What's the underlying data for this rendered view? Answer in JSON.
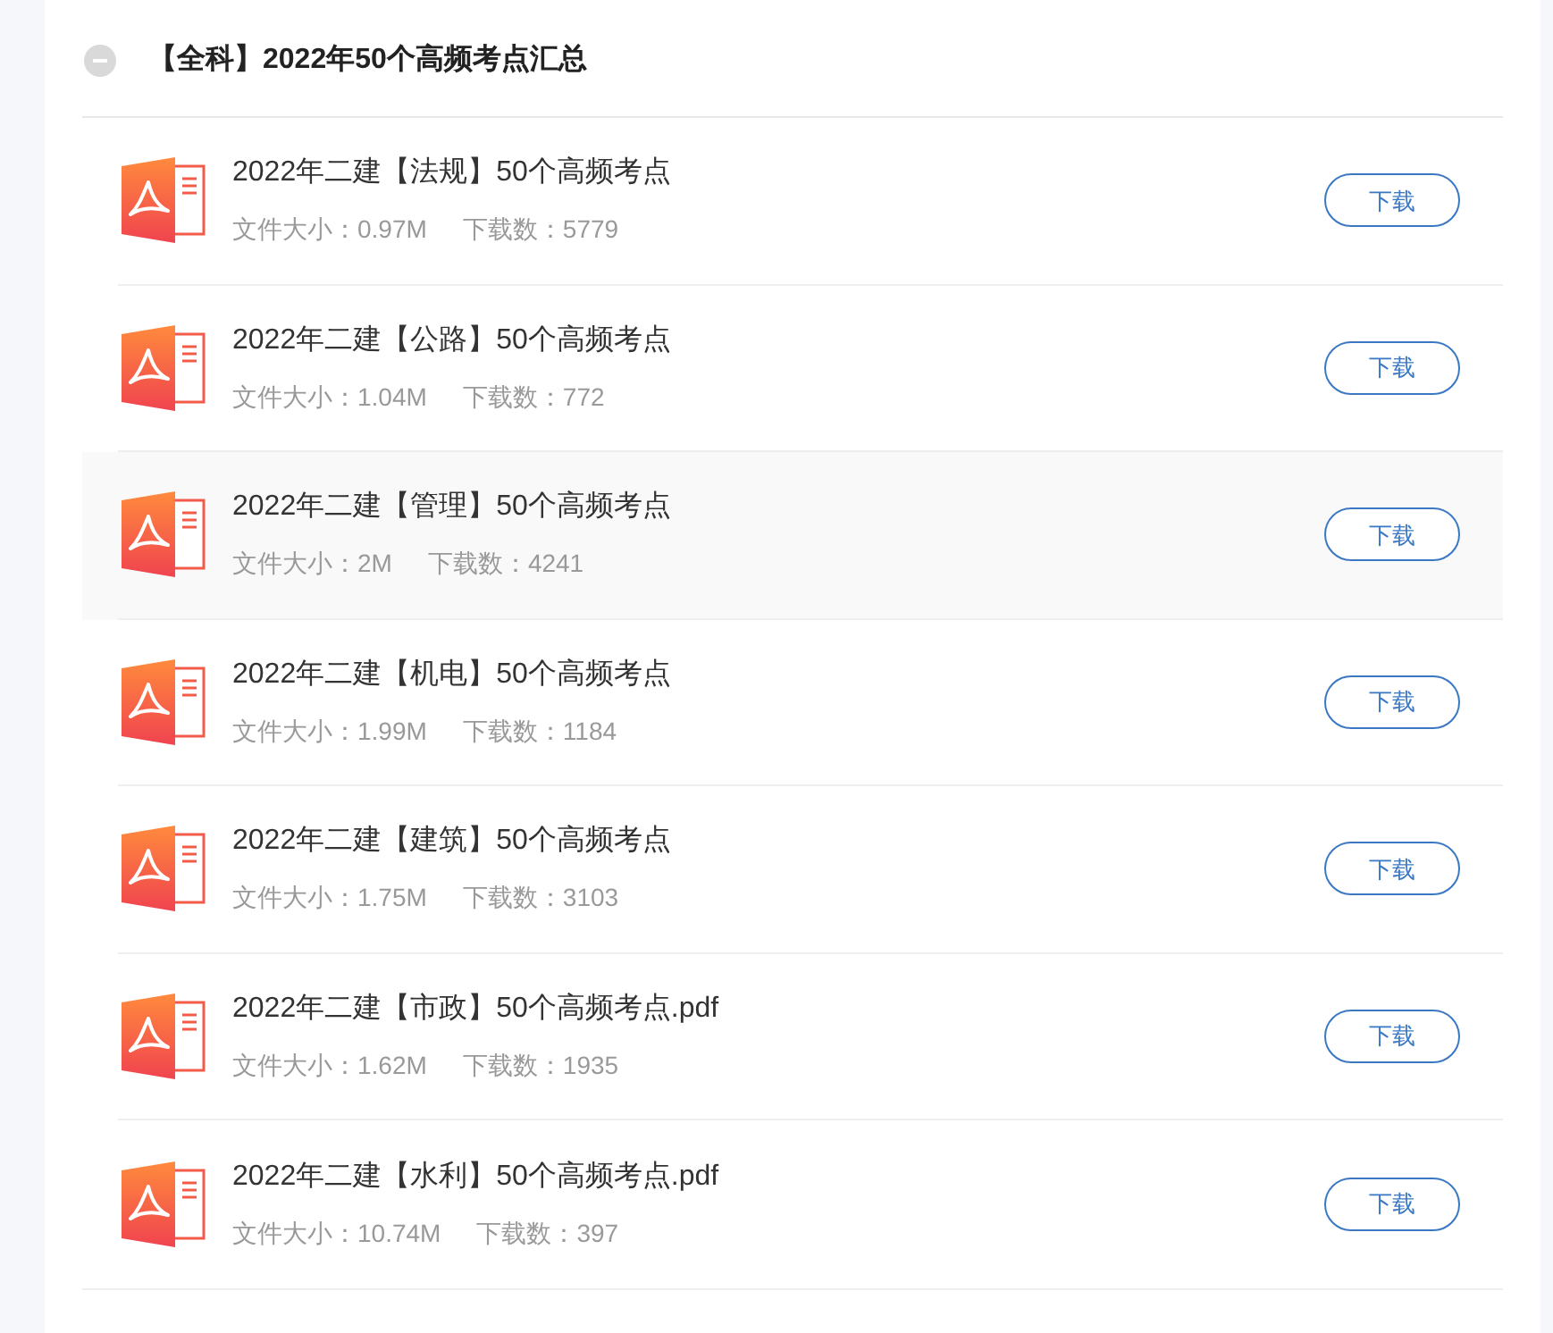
{
  "section": {
    "title": "【全科】2022年50个高频考点汇总",
    "expanded": true,
    "files": [
      {
        "name": "2022年二建【法规】50个高频考点",
        "size_label": "文件大小：0.97M",
        "downloads_label": "下载数：5779",
        "button": "下载",
        "hovered": false
      },
      {
        "name": "2022年二建【公路】50个高频考点",
        "size_label": "文件大小：1.04M",
        "downloads_label": "下载数：772",
        "button": "下载",
        "hovered": false
      },
      {
        "name": "2022年二建【管理】50个高频考点",
        "size_label": "文件大小：2M",
        "downloads_label": "下载数：4241",
        "button": "下载",
        "hovered": true
      },
      {
        "name": "2022年二建【机电】50个高频考点",
        "size_label": "文件大小：1.99M",
        "downloads_label": "下载数：1184",
        "button": "下载",
        "hovered": false
      },
      {
        "name": "2022年二建【建筑】50个高频考点",
        "size_label": "文件大小：1.75M",
        "downloads_label": "下载数：3103",
        "button": "下载",
        "hovered": false
      },
      {
        "name": "2022年二建【市政】50个高频考点.pdf",
        "size_label": "文件大小：1.62M",
        "downloads_label": "下载数：1935",
        "button": "下载",
        "hovered": false
      },
      {
        "name": "2022年二建【水利】50个高频考点.pdf",
        "size_label": "文件大小：10.74M",
        "downloads_label": "下载数：397",
        "button": "下载",
        "hovered": false
      }
    ]
  }
}
